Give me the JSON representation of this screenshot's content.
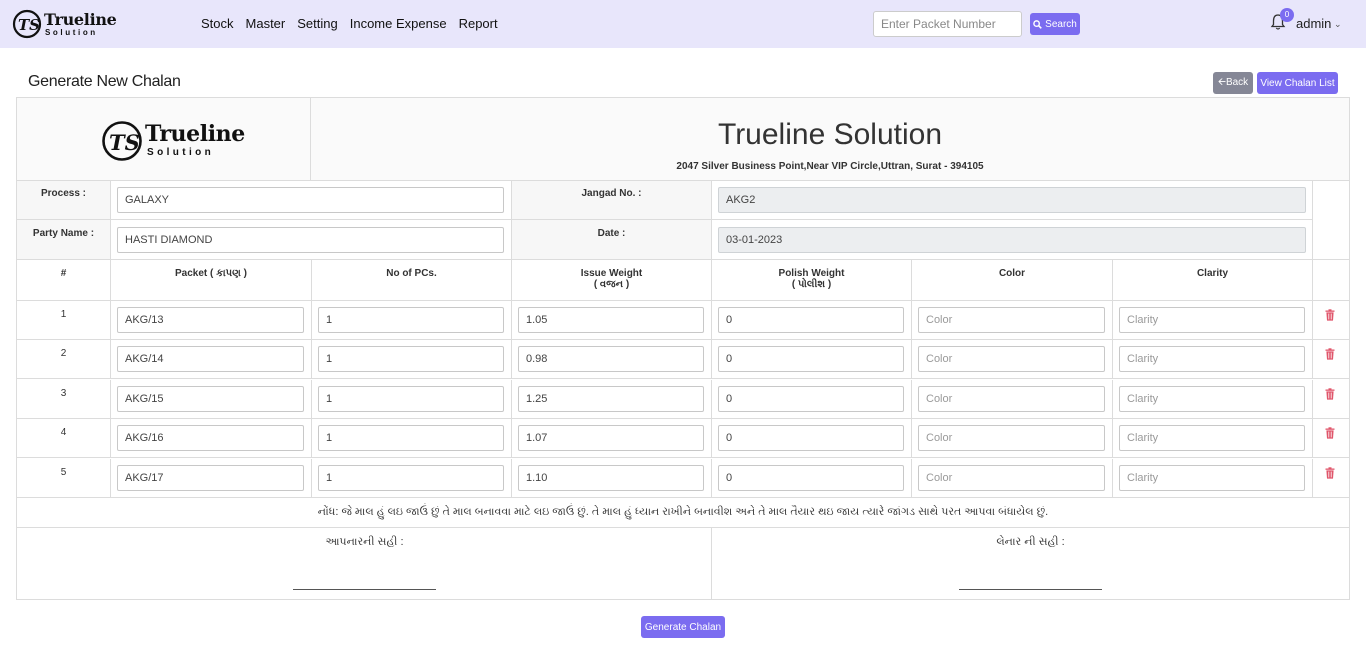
{
  "brand": {
    "name": "Trueline",
    "sub": "Solution"
  },
  "nav": [
    "Stock",
    "Master",
    "Setting",
    "Income Expense",
    "Report"
  ],
  "search": {
    "placeholder": "Enter Packet Number",
    "button": "Search"
  },
  "notifications": {
    "count": "0"
  },
  "user": {
    "name": "admin"
  },
  "page": {
    "title": "Generate New Chalan",
    "back": "Back",
    "view_list": "View Chalan List"
  },
  "company": {
    "name": "Trueline Solution",
    "address": "2047 Silver Business Point,Near VIP Circle,Uttran, Surat - 394105"
  },
  "form": {
    "process_label": "Process :",
    "process_value": "GALAXY",
    "jangad_label": "Jangad No. :",
    "jangad_value": "AKG2",
    "party_label": "Party Name :",
    "party_value": "HASTI DIAMOND",
    "date_label": "Date :",
    "date_value": "03-01-2023"
  },
  "table": {
    "headers": {
      "num": "#",
      "packet": "Packet ( કાપણ )",
      "pcs": "No of PCs.",
      "issue": "Issue Weight",
      "issue_sub": "( વજન )",
      "polish": "Polish Weight",
      "polish_sub": "( પોલીશ )",
      "color": "Color",
      "clarity": "Clarity"
    },
    "color_placeholder": "Color",
    "clarity_placeholder": "Clarity",
    "rows": [
      {
        "num": "1",
        "packet": "AKG/13",
        "pcs": "1",
        "issue": "1.05",
        "polish": "0"
      },
      {
        "num": "2",
        "packet": "AKG/14",
        "pcs": "1",
        "issue": "0.98",
        "polish": "0"
      },
      {
        "num": "3",
        "packet": "AKG/15",
        "pcs": "1",
        "issue": "1.25",
        "polish": "0"
      },
      {
        "num": "4",
        "packet": "AKG/16",
        "pcs": "1",
        "issue": "1.07",
        "polish": "0"
      },
      {
        "num": "5",
        "packet": "AKG/17",
        "pcs": "1",
        "issue": "1.10",
        "polish": "0"
      }
    ]
  },
  "note": "નોંધ: જે માલ હું લઇ જાઉં છું તે માલ બનાવવા માટે લઇ જાઉં છું. તે માલ હું ધ્યાન રાખીને બનાવીશ અને તે માલ તૈયાર થઇ જાય ત્યારે જાંગડ સાથે પરત આપવા બંધાયેલ છું.",
  "signatures": {
    "giver": "આપનારની સહી :",
    "receiver": "લેનાર ની સહી :"
  },
  "generate": "Generate Chalan"
}
